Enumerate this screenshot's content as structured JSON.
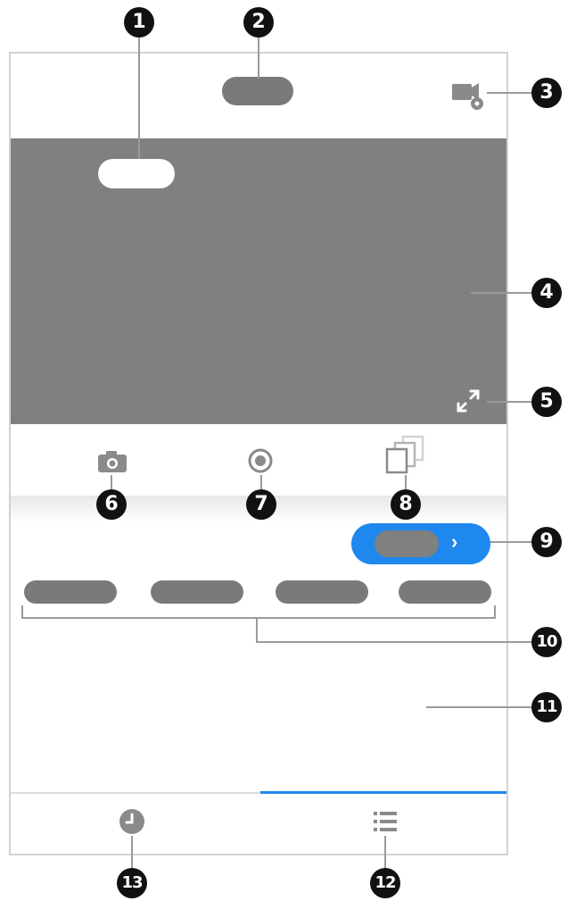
{
  "callouts": [
    "1",
    "2",
    "3",
    "4",
    "5",
    "6",
    "7",
    "8",
    "9",
    "10",
    "11",
    "12",
    "13"
  ],
  "icons": {
    "header_settings": "video-settings-icon",
    "fullscreen": "fullscreen-icon",
    "snapshot": "camera-icon",
    "record": "record-icon",
    "multi_view": "multi-screen-icon",
    "chevron": "chevron-right-icon",
    "playback": "clock-icon",
    "list": "list-icon"
  },
  "colors": {
    "accent": "#1e88ee",
    "placeholder": "#7a7a7a",
    "video_bg": "#808080",
    "frame": "#d2d2d2"
  },
  "blue_button": {
    "chevron": "›"
  }
}
